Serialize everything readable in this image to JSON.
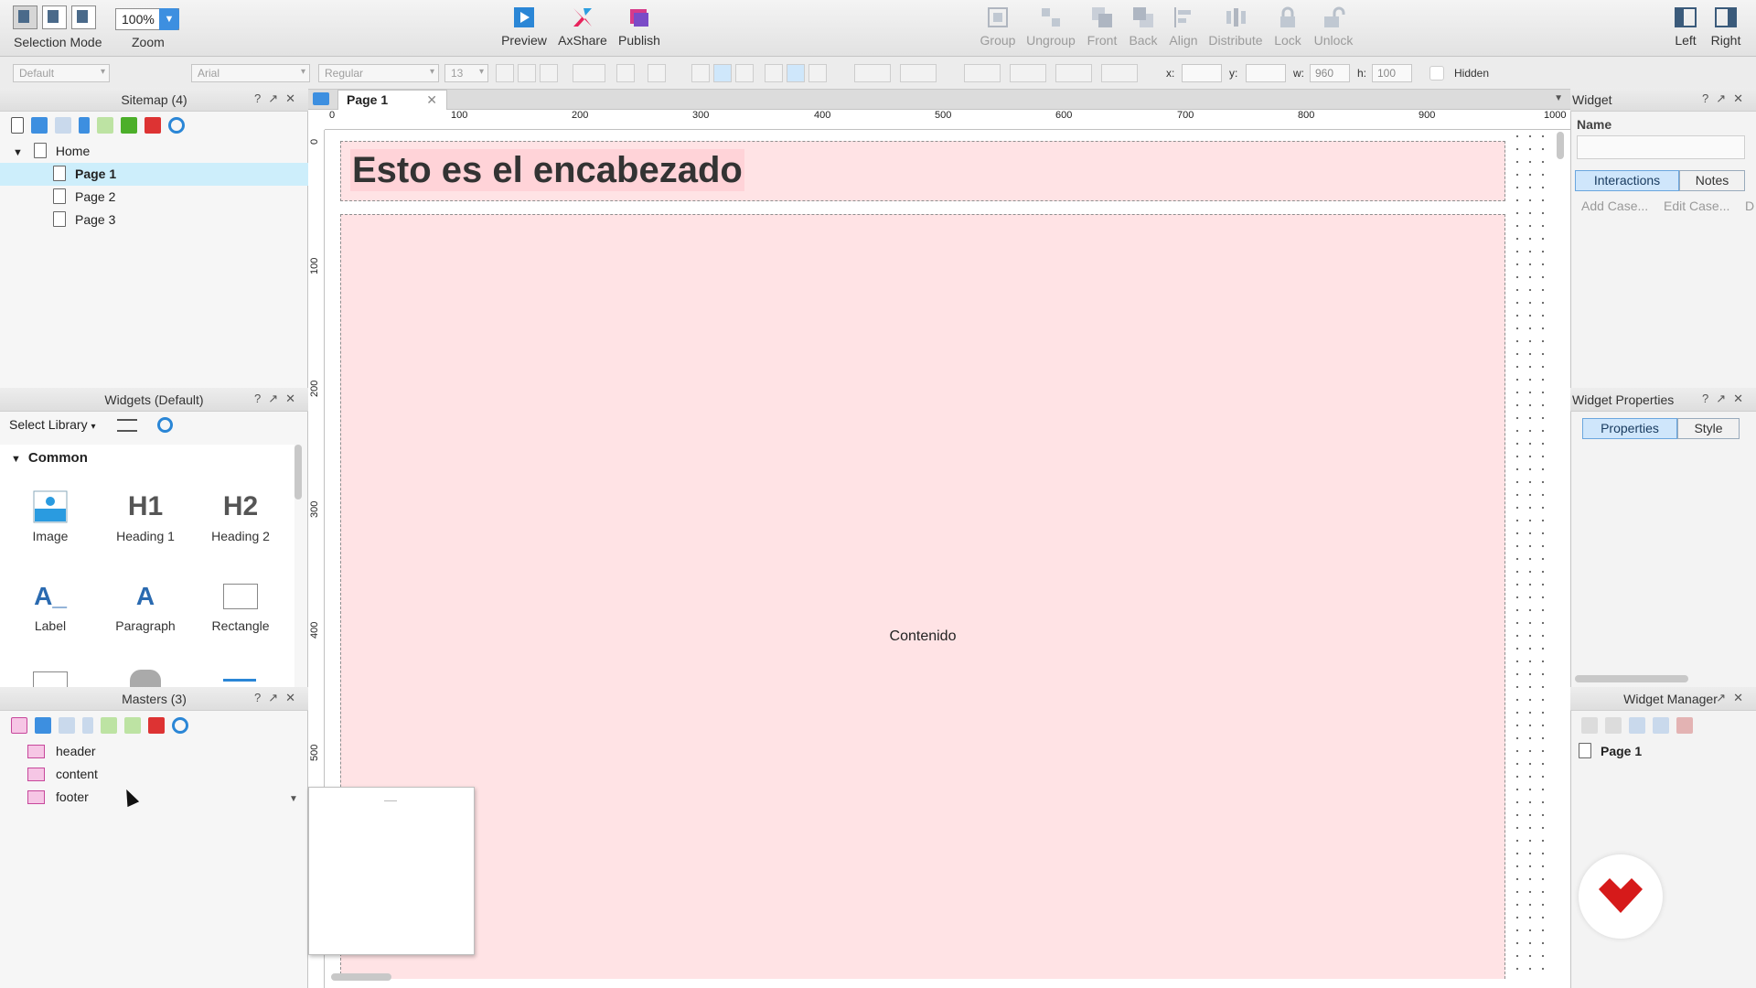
{
  "toolbar": {
    "selection_mode": "Selection Mode",
    "zoom_label": "Zoom",
    "zoom_value": "100%",
    "preview": "Preview",
    "axshare": "AxShare",
    "publish": "Publish",
    "group": "Group",
    "ungroup": "Ungroup",
    "front": "Front",
    "back": "Back",
    "align": "Align",
    "distribute": "Distribute",
    "lock": "Lock",
    "unlock": "Unlock",
    "left": "Left",
    "right": "Right"
  },
  "format_bar": {
    "style": "Default",
    "font": "Arial",
    "weight": "Regular",
    "size": "13",
    "x_label": "x:",
    "y_label": "y:",
    "w_label": "w:",
    "w_value": "960",
    "h_label": "h:",
    "h_value": "100",
    "hidden_label": "Hidden"
  },
  "sitemap": {
    "title": "Sitemap (4)",
    "root": "Home",
    "pages": [
      "Page 1",
      "Page 2",
      "Page 3"
    ]
  },
  "widgets": {
    "title": "Widgets (Default)",
    "select_library": "Select Library",
    "section": "Common",
    "items": [
      "Image",
      "Heading 1",
      "Heading 2",
      "Label",
      "Paragraph",
      "Rectangle"
    ],
    "h1_glyph": "H1",
    "h2_glyph": "H2",
    "label_glyph": "A_",
    "paragraph_glyph": "A"
  },
  "masters": {
    "title": "Masters (3)",
    "items": [
      "header",
      "content",
      "footer"
    ]
  },
  "canvas": {
    "tab": "Page 1",
    "ruler_h": [
      "0",
      "100",
      "200",
      "300",
      "400",
      "500",
      "600",
      "700",
      "800",
      "900",
      "1000"
    ],
    "ruler_v": [
      "0",
      "100",
      "200",
      "300",
      "400",
      "500"
    ],
    "header_text": "Esto es el encabezado",
    "content_text": "Contenido"
  },
  "widget_panel": {
    "title": "Widget",
    "name_label": "Name",
    "tab_interactions": "Interactions",
    "tab_notes": "Notes",
    "add_case": "Add Case...",
    "edit_case": "Edit Case...",
    "edit_case_cut": "D"
  },
  "widget_properties": {
    "title": "Widget Properties",
    "tab_properties": "Properties",
    "tab_style": "Style"
  },
  "widget_manager": {
    "title": "Widget Manager",
    "page": "Page 1"
  },
  "colors": {
    "accent": "#3d8fe0",
    "canvas_fill": "#ffe3e5",
    "selection": "#cdeefb",
    "master_icon": "#f6c6e5",
    "logo": "#d61a1a"
  }
}
